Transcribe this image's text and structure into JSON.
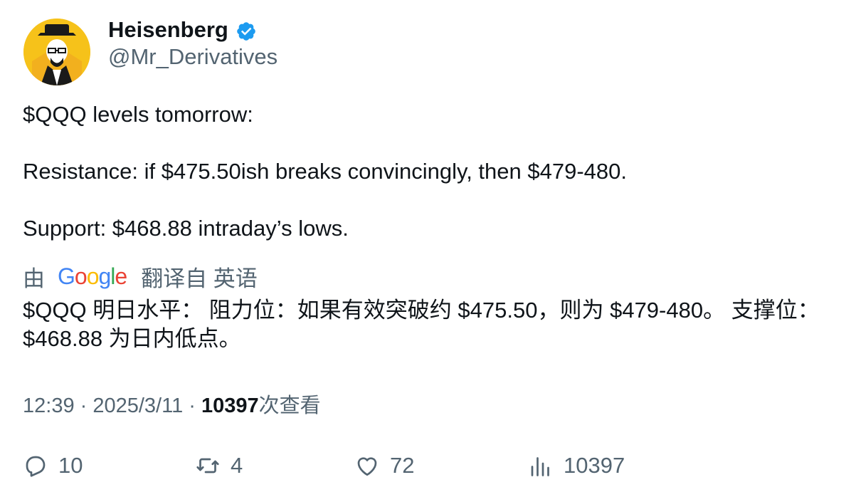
{
  "author": {
    "display_name": "Heisenberg",
    "handle": "@Mr_Derivatives",
    "verified_icon": "verified-badge-icon"
  },
  "tweet": {
    "lines": [
      "$QQQ levels tomorrow:",
      "Resistance: if $475.50ish breaks convincingly, then $479-480.",
      "Support: $468.88 intraday’s lows."
    ]
  },
  "translation": {
    "prefix": "由",
    "provider": "Google",
    "suffix": "翻译自 英语",
    "text": "$QQQ 明日水平： 阻力位：如果有效突破约 $475.50，则为 $479-480。 支撑位：$468.88 为日内低点。"
  },
  "meta": {
    "time": "12:39",
    "sep1": " · ",
    "date": "2025/3/11",
    "sep2": " · ",
    "views_count": "10397",
    "views_label": "次查看"
  },
  "actions": {
    "replies": "10",
    "retweets": "4",
    "likes": "72",
    "views": "10397"
  },
  "colors": {
    "text": "#0f1419",
    "secondary": "#536471",
    "verified": "#1d9bf0",
    "avatar_bg": "#f6c21a"
  }
}
